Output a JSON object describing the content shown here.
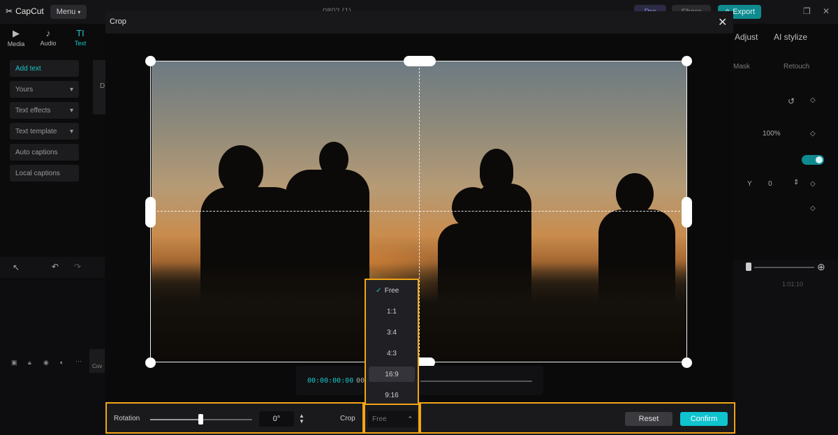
{
  "app": {
    "logo_text": "CapCut",
    "menu_label": "Menu",
    "project_title": "0802 (1)",
    "pro_label": "Pro",
    "share_label": "Share",
    "export_label": "Export"
  },
  "left_tabs": [
    {
      "icon": "▶",
      "label": "Media"
    },
    {
      "icon": "♪",
      "label": "Audio"
    },
    {
      "icon": "TI",
      "label": "Text"
    }
  ],
  "sidebar": {
    "items": [
      "Add text",
      "Yours",
      "Text effects",
      "Text template",
      "Auto captions",
      "Local captions"
    ]
  },
  "behind_card_letter": "D",
  "right_panel": {
    "tab_adjust": "Adjust",
    "tab_ai_stylize": "AI stylize",
    "sub_mask": "Mask",
    "sub_retouch": "Retouch",
    "scale_value": "100%",
    "y_label": "Y",
    "y_value": "0",
    "timeline_label": "1:01:10"
  },
  "timeline_track_cover": "Cov",
  "modal": {
    "title": "Crop",
    "playback": {
      "current_time": "00:00:00:00",
      "total_time_partial": "00"
    },
    "dropdown": {
      "options": [
        "Free",
        "1:1",
        "3:4",
        "4:3",
        "16:9",
        "9:16"
      ],
      "selected": "Free",
      "hovered": "16:9"
    },
    "bottom": {
      "rotation_label": "Rotation",
      "rotation_value": "0°",
      "crop_label": "Crop",
      "crop_value": "Free",
      "reset_label": "Reset",
      "confirm_label": "Confirm"
    }
  },
  "colors": {
    "accent": "#19c6c6",
    "highlight": "#f3a516",
    "confirm": "#0fc3cf"
  }
}
